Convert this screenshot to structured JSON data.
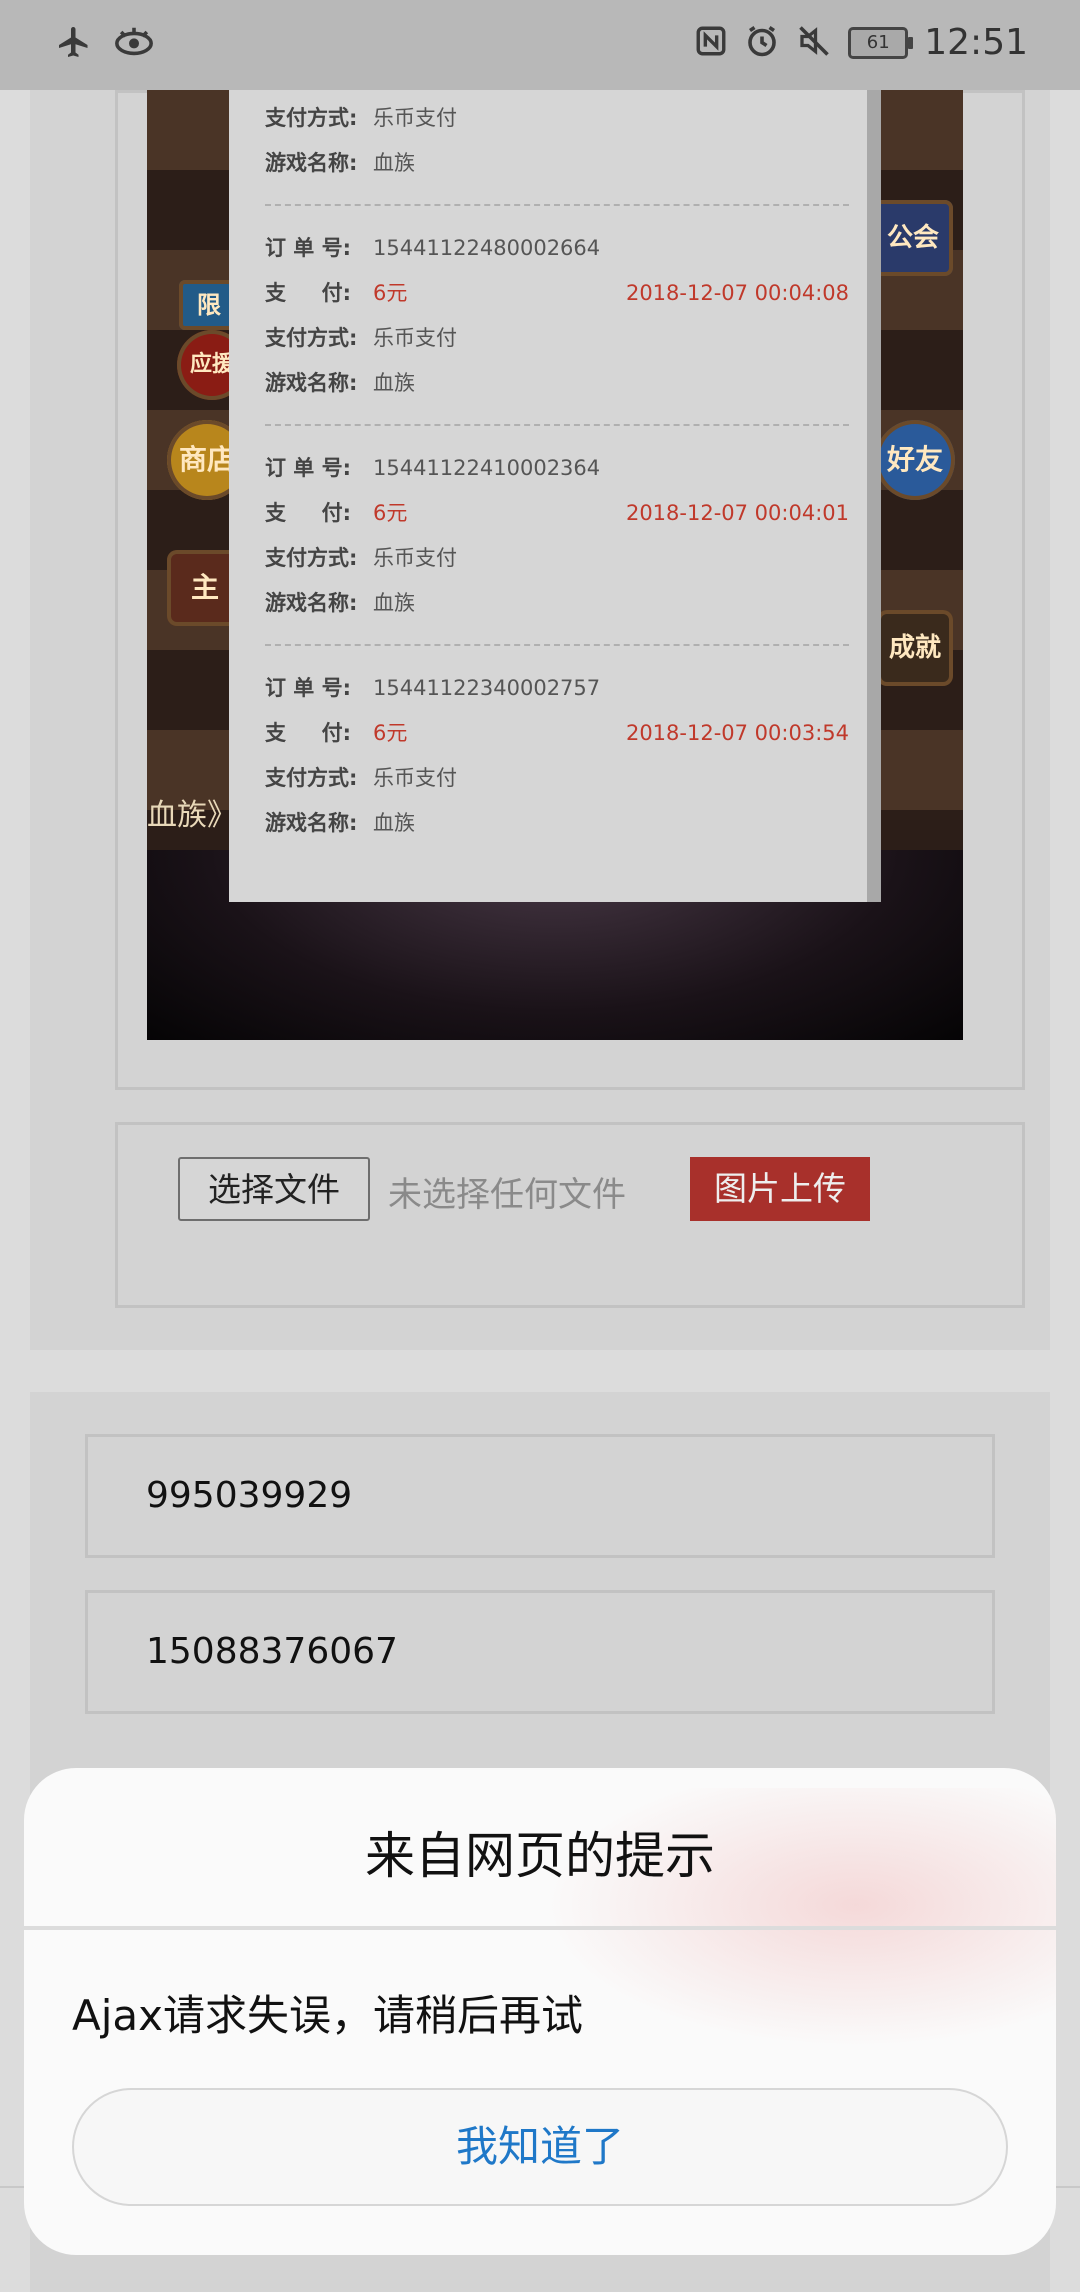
{
  "status_bar": {
    "time": "12:51",
    "battery": "61",
    "left_icons": [
      "airplane-icon",
      "eye-icon"
    ],
    "right_icons": [
      "nfc-icon",
      "alarm-icon",
      "mute-icon"
    ]
  },
  "game_screenshot": {
    "left_chips": [
      "应援",
      "商店",
      "主"
    ],
    "right_chips": [
      "公会",
      "好友",
      "成就"
    ],
    "bottom_text": "血族》的",
    "limit_badge": "限"
  },
  "orders": [
    {
      "order_no": "",
      "pay_label": "",
      "pay_amount": "",
      "date": "",
      "method_label": "支付方式:",
      "method": "乐币支付",
      "game_label": "游戏名称:",
      "game": "血族"
    },
    {
      "order_no_label": "订 单 号:",
      "order_no": "15441122480002664",
      "pay_label": "支 　 付:",
      "pay_amount": "6元",
      "date": "2018-12-07 00:04:08",
      "method_label": "支付方式:",
      "method": "乐币支付",
      "game_label": "游戏名称:",
      "game": "血族"
    },
    {
      "order_no_label": "订 单 号:",
      "order_no": "15441122410002364",
      "pay_label": "支 　 付:",
      "pay_amount": "6元",
      "date": "2018-12-07 00:04:01",
      "method_label": "支付方式:",
      "method": "乐币支付",
      "game_label": "游戏名称:",
      "game": "血族"
    },
    {
      "order_no_label": "订 单 号:",
      "order_no": "15441122340002757",
      "pay_label": "支 　 付:",
      "pay_amount": "6元",
      "date": "2018-12-07 00:03:54",
      "method_label": "支付方式:",
      "method": "乐币支付",
      "game_label": "游戏名称:",
      "game": "血族"
    }
  ],
  "upload": {
    "choose_file_label": "选择文件",
    "no_file_text": "未选择任何文件",
    "upload_label": "图片上传"
  },
  "fields": {
    "qq": "995039929",
    "phone": "15088376067"
  },
  "dialog": {
    "title": "来自网页的提示",
    "message": "Ajax请求失误，请稍后再试",
    "ok_label": "我知道了"
  },
  "colors": {
    "accent_red": "#a8302b",
    "price_red": "#c0392b",
    "link_blue": "#1f78c8"
  }
}
